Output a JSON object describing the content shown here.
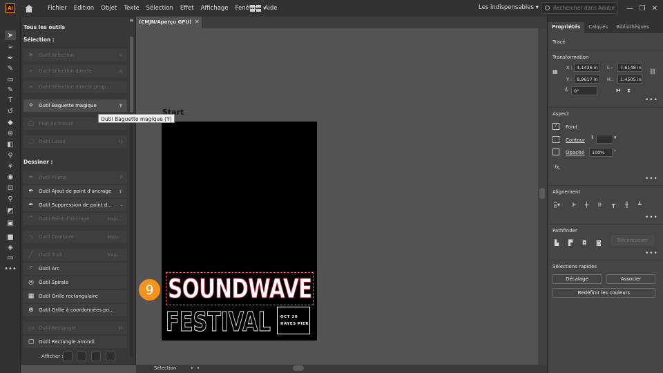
{
  "app": {
    "logo": "Ai"
  },
  "menu": [
    "Fichier",
    "Edition",
    "Objet",
    "Texte",
    "Sélection",
    "Effet",
    "Affichage",
    "Fenêtre",
    "Aide"
  ],
  "workspace": "Les indispensables",
  "search_placeholder": "Rechercher dans Adobe Stock",
  "window_buttons": [
    "—",
    "❐",
    "✕"
  ],
  "document_tab": {
    "label": "(CMJN/Aperçu GPU)",
    "close": "✕"
  },
  "tool_panel": {
    "title": "Tous les outils",
    "sections": [
      {
        "label": "Sélection :",
        "tools": [
          {
            "label": "Outil Sélection",
            "shortcut": "V",
            "state": "dim",
            "icon": "selection-arrow-icon",
            "glyph": "➤"
          },
          {
            "label": "Outil Sélection directe",
            "shortcut": "A",
            "state": "dim",
            "icon": "direct-selection-icon",
            "glyph": "➢"
          },
          {
            "label": "Outil Sélection directe progr...",
            "shortcut": "",
            "state": "dim",
            "icon": "group-selection-icon",
            "glyph": "➢"
          },
          {
            "label": "Outil Baguette magique",
            "shortcut": "Y",
            "state": "hl",
            "icon": "magic-wand-icon",
            "glyph": "✧"
          },
          {
            "label": "Plan de travail",
            "shortcut": "",
            "state": "dim",
            "icon": "artboard-icon",
            "glyph": "▢"
          },
          {
            "label": "Outil Lasso",
            "shortcut": "Q",
            "state": "dim",
            "icon": "lasso-icon",
            "glyph": "◌"
          }
        ]
      },
      {
        "label": "Dessiner :",
        "tools": [
          {
            "label": "Outil Plume",
            "shortcut": "P",
            "state": "dim",
            "icon": "pen-icon",
            "glyph": "✒"
          },
          {
            "label": "Outil Ajout de point d'ancrage",
            "shortcut": "+",
            "state": "on",
            "icon": "add-anchor-icon",
            "glyph": "✒"
          },
          {
            "label": "Outil Suppression de point d...",
            "shortcut": "-",
            "state": "on",
            "icon": "delete-anchor-icon",
            "glyph": "✒"
          },
          {
            "label": "Outil Point d'ancrage",
            "shortcut": "Maju...",
            "state": "dim",
            "icon": "anchor-point-icon",
            "glyph": "⌃"
          },
          {
            "label": "Outil Courbure",
            "shortcut": "Maju...",
            "state": "dim",
            "icon": "curvature-icon",
            "glyph": "∿"
          },
          {
            "label": "Outil Trait",
            "shortcut": "Maju...",
            "state": "dim",
            "icon": "line-icon",
            "glyph": "╱"
          },
          {
            "label": "Outil Arc",
            "shortcut": "",
            "state": "on",
            "icon": "arc-icon",
            "glyph": "◜"
          },
          {
            "label": "Outil Spirale",
            "shortcut": "",
            "state": "on",
            "icon": "spiral-icon",
            "glyph": "◎"
          },
          {
            "label": "Outil Grille rectangulaire",
            "shortcut": "",
            "state": "on",
            "icon": "rect-grid-icon",
            "glyph": "▦"
          },
          {
            "label": "Outil Grille à coordonnées po...",
            "shortcut": "",
            "state": "on",
            "icon": "polar-grid-icon",
            "glyph": "⊕"
          },
          {
            "label": "Outil Rectangle",
            "shortcut": "M",
            "state": "dim",
            "icon": "rectangle-icon",
            "glyph": "▭"
          },
          {
            "label": "Outil Rectangle arrondi",
            "shortcut": "",
            "state": "on",
            "icon": "rounded-rectangle-icon",
            "glyph": "▢"
          }
        ]
      }
    ],
    "footer_label": "Afficher :"
  },
  "tooltip": "Outil Baguette magique (Y)",
  "artboard": {
    "label": "Start",
    "line1": "SOUNDWAVE",
    "line2": "FESTIVAL",
    "date_line1": "OCT 20",
    "date_line2": "HAYES PIER"
  },
  "step_marker": "9",
  "status": {
    "tool": "Sélection"
  },
  "right_panel": {
    "tabs": [
      "Propriétés",
      "Calques",
      "Bibliothèques"
    ],
    "object_type": "Tracé",
    "transformation": {
      "title": "Transformation",
      "x_label": "X :",
      "x": "4,1436 in",
      "y_label": "Y :",
      "y": "8,9617 in",
      "w_label": "L :",
      "w": "7,6148 in",
      "h_label": "H :",
      "h": "1,4505 in",
      "angle": "0°"
    },
    "aspect": {
      "title": "Aspect",
      "fill_label": "Fond",
      "stroke_label": "Contour",
      "opacity_label": "Opacité",
      "opacity": "100%",
      "fx_label": "fx."
    },
    "alignment_title": "Alignement",
    "pathfinder": {
      "title": "Pathfinder",
      "expand": "Décomposer"
    },
    "quick_actions": {
      "title": "Sélections rapides",
      "offset": "Décalage",
      "join": "Associer",
      "recolor": "Redéfinir les couleurs"
    }
  },
  "colors": {
    "accent_marker": "#f7921e",
    "title_stroke": "#c41e3a",
    "selection_dash": "#ff5a5a"
  }
}
